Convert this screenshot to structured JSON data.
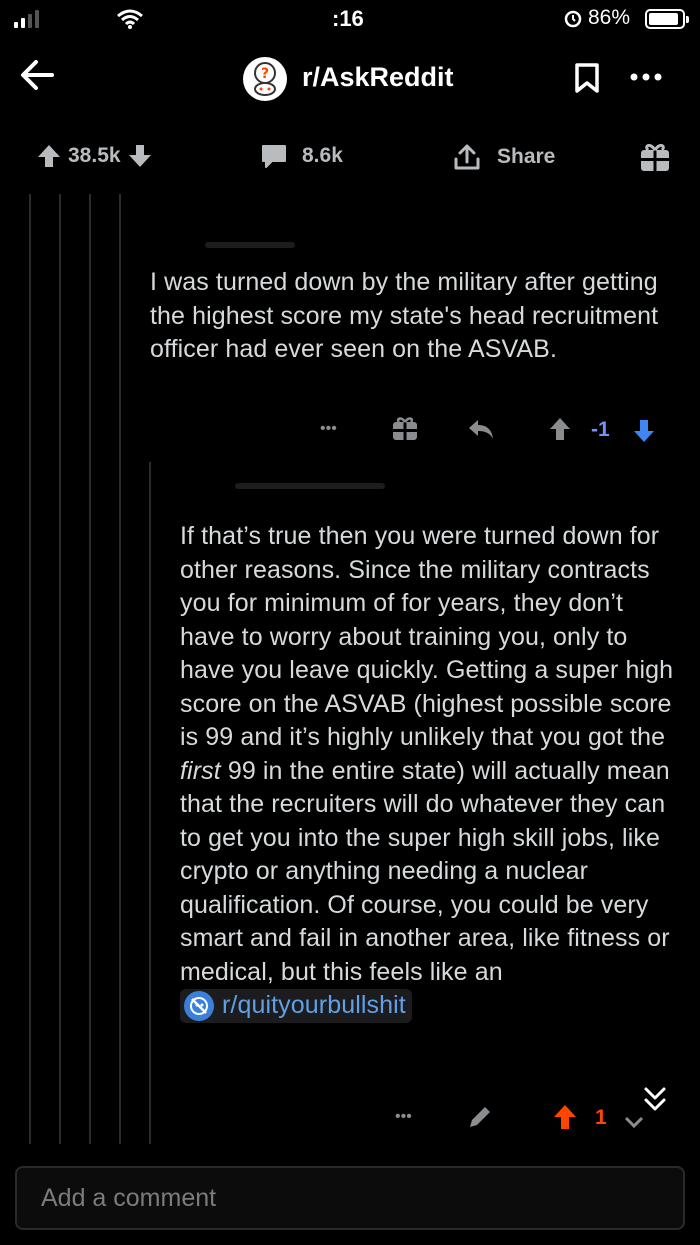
{
  "status_bar": {
    "time": ":16",
    "battery": "86%"
  },
  "header": {
    "subreddit": "r/AskReddit"
  },
  "post_actions": {
    "upvotes": "38.5k",
    "comments": "8.6k",
    "share": "Share"
  },
  "comment1": {
    "text": "I was turned down by the military after getting the highest score my state's head recruitment officer had ever seen on the ASVAB.",
    "votes": "-1",
    "more": "•••"
  },
  "comment2": {
    "text_before": "If that’s true then you were turned down for other reasons.  Since the military contracts you for minimum of for years, they don’t have to worry about training you, only to have you leave quickly.  Getting a super high score on the ASVAB (highest possible score is 99 and it’s highly unlikely that you got the ",
    "text_italic": "first",
    "text_after": " 99 in the entire state) will actually mean that the recruiters will do whatever they can to get you into the super high skill jobs, like crypto or anything needing a nuclear qualification.  Of course, you could be very smart and fail in another area, like fitness or medical, but this feels like an ",
    "link": "r/quityourbullshit",
    "votes": "1",
    "more": "•••"
  },
  "composer": {
    "placeholder": "Add a comment"
  },
  "colors": {
    "background": "#000000",
    "text": "#d7dadc",
    "downvote": "#7193ff",
    "upvote": "#ff4500",
    "link": "#5fa0e8"
  }
}
